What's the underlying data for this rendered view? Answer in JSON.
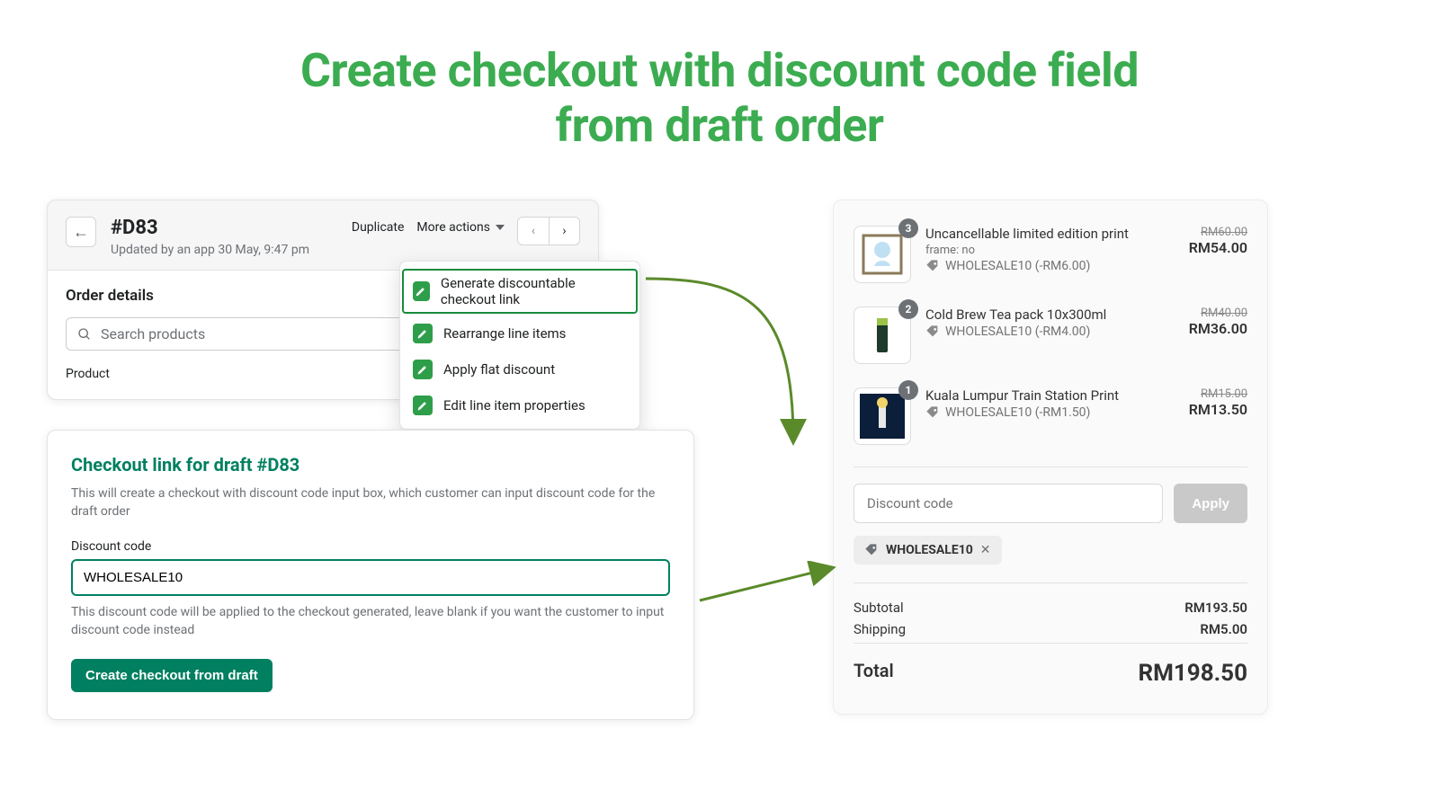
{
  "headline_l1": "Create checkout with discount code field",
  "headline_l2": "from draft order",
  "admin": {
    "order_number": "#D83",
    "updated_by": "Updated by an app 30 May, 9:47 pm",
    "duplicate": "Duplicate",
    "more_actions": "More actions",
    "order_details_title": "Order details",
    "search_placeholder": "Search products",
    "product_col": "Product"
  },
  "dropdown": {
    "items": [
      "Generate discountable checkout link",
      "Rearrange line items",
      "Apply flat discount",
      "Edit line item properties"
    ]
  },
  "form": {
    "title": "Checkout link for draft #D83",
    "description": "This will create a checkout with discount code input box, which customer can input discount code for the draft order",
    "field_label": "Discount code",
    "field_value": "WHOLESALE10",
    "hint": "This discount code will be applied to the checkout generated, leave blank if you want the customer to input discount code instead",
    "cta": "Create checkout from draft"
  },
  "cart": {
    "items": [
      {
        "qty": "3",
        "name": "Uncancellable limited edition print",
        "variant": "frame: no",
        "discount_label": "WHOLESALE10 (-RM6.00)",
        "orig": "RM60.00",
        "now": "RM54.00"
      },
      {
        "qty": "2",
        "name": "Cold Brew Tea pack 10x300ml",
        "variant": "",
        "discount_label": "WHOLESALE10 (-RM4.00)",
        "orig": "RM40.00",
        "now": "RM36.00"
      },
      {
        "qty": "1",
        "name": "Kuala Lumpur Train Station Print",
        "variant": "",
        "discount_label": "WHOLESALE10 (-RM1.50)",
        "orig": "RM15.00",
        "now": "RM13.50"
      }
    ],
    "discount_placeholder": "Discount code",
    "apply": "Apply",
    "chip": "WHOLESALE10",
    "subtotal_label": "Subtotal",
    "subtotal_value": "RM193.50",
    "shipping_label": "Shipping",
    "shipping_value": "RM5.00",
    "total_label": "Total",
    "total_value": "RM198.50"
  }
}
